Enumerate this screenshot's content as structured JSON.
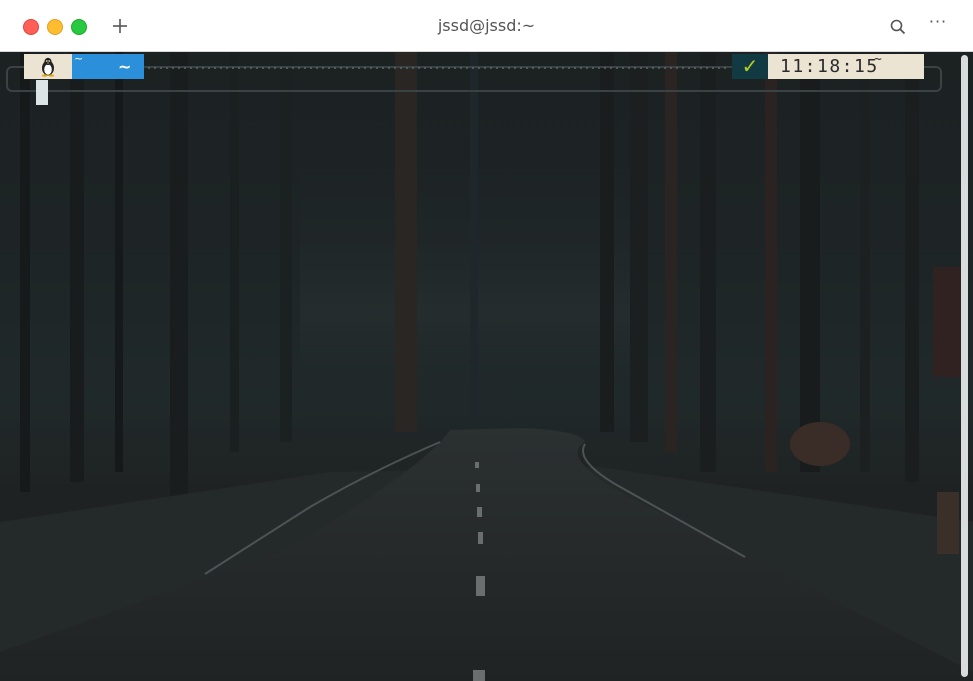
{
  "window": {
    "title": "jssd@jssd:~",
    "more_label": "···"
  },
  "prompt": {
    "os_icon": "tux-penguin-icon",
    "dir_tilde": "~",
    "dir_path": "~",
    "status_mark": "✓",
    "time": "11:18:15",
    "time_tilde": "~"
  },
  "colors": {
    "os_segment_bg": "#ece4d3",
    "dir_segment_bg": "#2b90d9",
    "status_segment_bg": "#123a42",
    "status_mark": "#b8cc24",
    "time_segment_bg": "#ece4d3",
    "cursor": "#dce4e6"
  }
}
